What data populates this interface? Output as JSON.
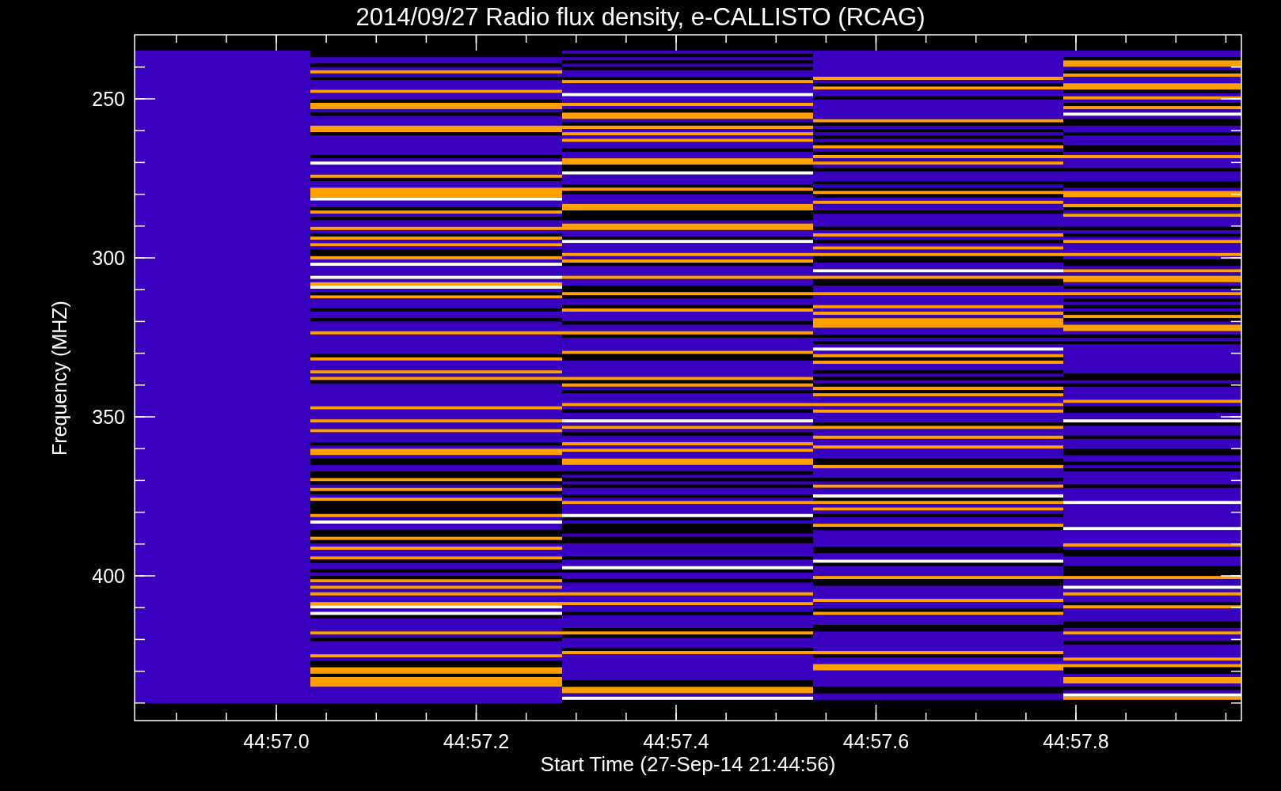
{
  "title": "2014/09/27  Radio flux density, e-CALLISTO (RCAG)",
  "x_axis": {
    "label": "Start Time (27-Sep-14 21:44:56)",
    "ticks": [
      "44:57.0",
      "44:57.2",
      "44:57.4",
      "44:57.6",
      "44:57.8"
    ]
  },
  "y_axis": {
    "label": "Frequency (MHZ)",
    "ticks": [
      "250",
      "300",
      "350",
      "400"
    ]
  }
}
